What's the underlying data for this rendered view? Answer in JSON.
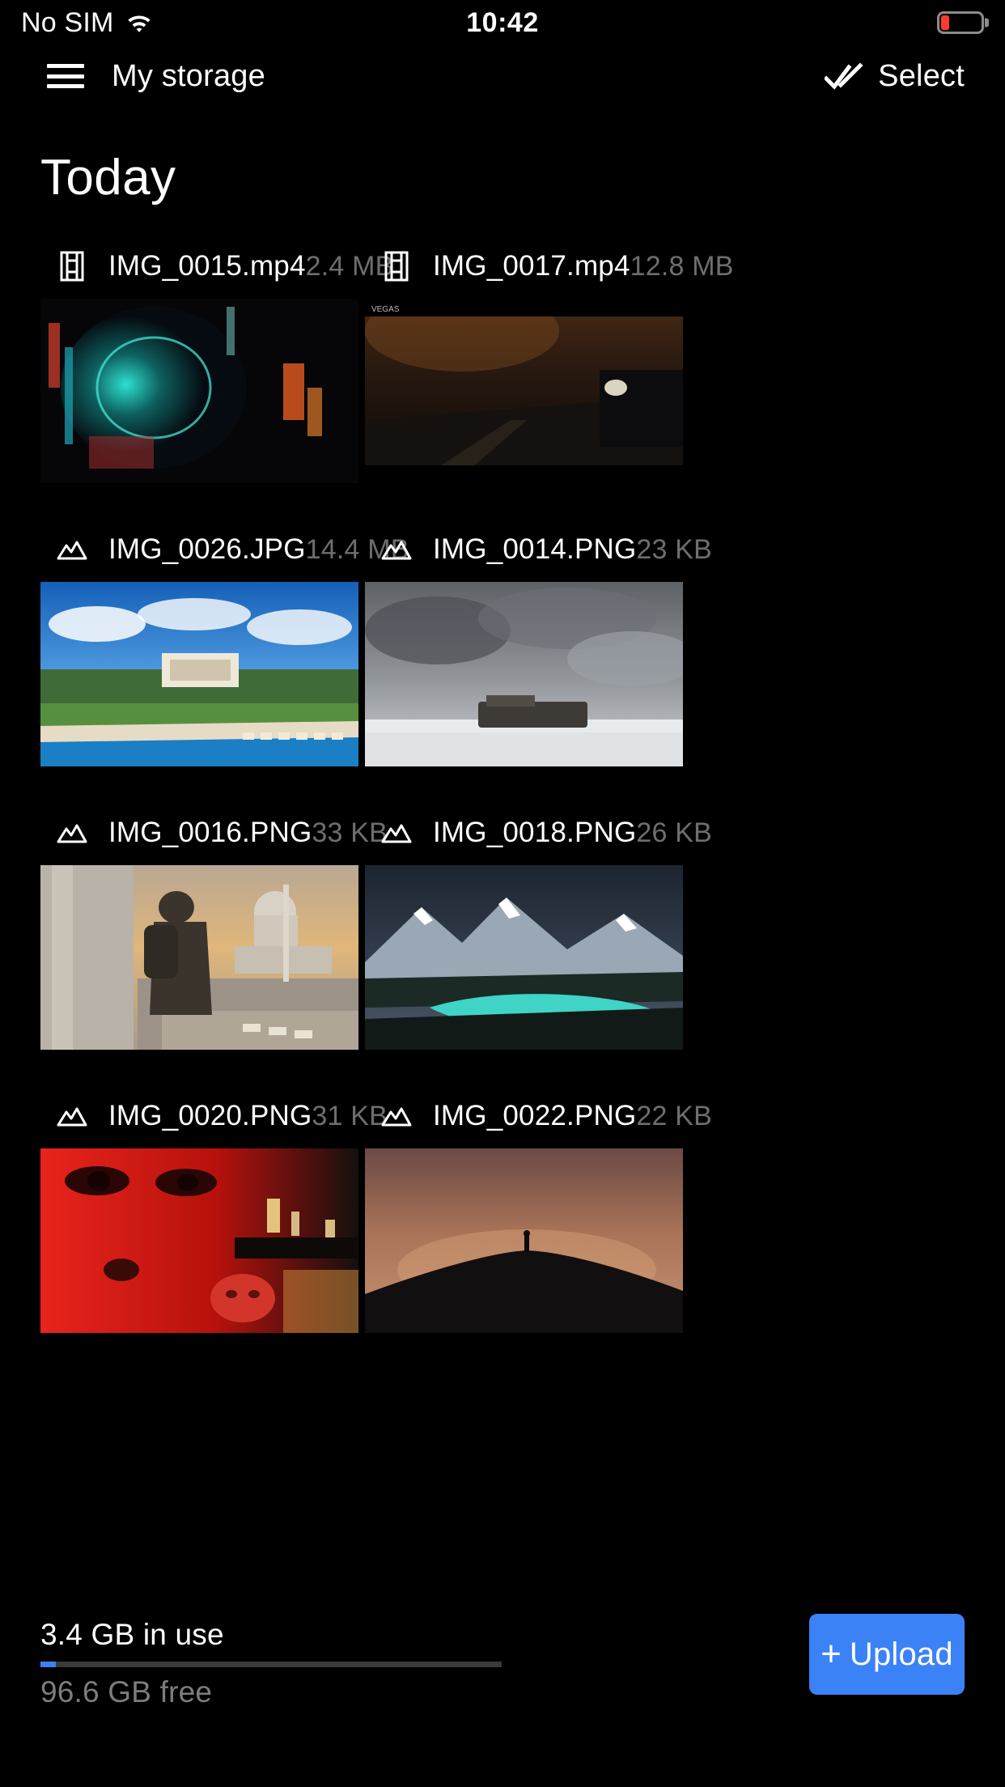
{
  "status_bar": {
    "carrier": "No SIM",
    "wifi_icon": "wifi-icon",
    "time": "10:42",
    "battery_icon": "battery-low-icon",
    "battery_level_pct": 20,
    "battery_color": "#ff3b30"
  },
  "nav": {
    "menu_icon": "hamburger-menu-icon",
    "title": "My storage",
    "select_icon": "double-check-icon",
    "select_label": "Select"
  },
  "section": {
    "title": "Today"
  },
  "files": [
    {
      "name": "IMG_0015.mp4",
      "size": "2.4 MB",
      "icon": "video-file-icon",
      "type": "video",
      "thumb": "abstract-teal-orb-lens-flare"
    },
    {
      "name": "IMG_0017.mp4",
      "size": "12.8 MB",
      "icon": "video-file-icon",
      "type": "video",
      "thumb": "dark-road-car-at-dusk"
    },
    {
      "name": "IMG_0026.JPG",
      "size": "14.4 MB",
      "icon": "image-file-icon",
      "type": "image",
      "thumb": "panorama-villa-pool-blue-sky"
    },
    {
      "name": "IMG_0014.PNG",
      "size": "23 KB",
      "icon": "image-file-icon",
      "type": "image",
      "thumb": "storm-clouds-over-snow-wreck"
    },
    {
      "name": "IMG_0016.PNG",
      "size": "33 KB",
      "icon": "image-file-icon",
      "type": "image",
      "thumb": "backpacker-near-capitol-building"
    },
    {
      "name": "IMG_0018.PNG",
      "size": "26 KB",
      "icon": "image-file-icon",
      "type": "image",
      "thumb": "snowy-mountains-turquoise-lake"
    },
    {
      "name": "IMG_0020.PNG",
      "size": "31 KB",
      "icon": "image-file-icon",
      "type": "image",
      "thumb": "red-lit-faces-neon"
    },
    {
      "name": "IMG_0022.PNG",
      "size": "22 KB",
      "icon": "image-file-icon",
      "type": "image",
      "thumb": "lone-figure-on-hill-dusk"
    }
  ],
  "footer": {
    "used_label": "3.4 GB in use",
    "free_label": "96.6 GB free",
    "used_pct": 3.4,
    "progress_color": "#3b82f6",
    "upload_plus": "+",
    "upload_label": "Upload",
    "upload_color": "#3b82f6"
  }
}
